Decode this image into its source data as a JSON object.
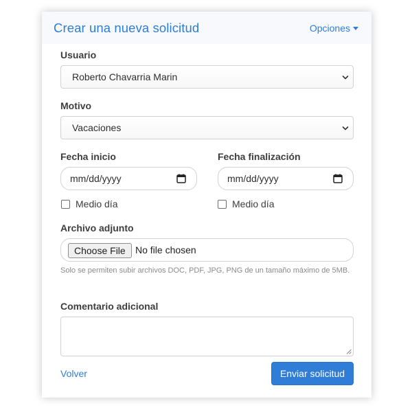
{
  "header": {
    "title": "Crear una nueva solicitud",
    "options_label": "Opciones",
    "options_icon": "caret-down-icon"
  },
  "form": {
    "usuario": {
      "label": "Usuario",
      "selected": "Roberto Chavarria Marin"
    },
    "motivo": {
      "label": "Motivo",
      "selected": "Vacaciones"
    },
    "fecha_inicio": {
      "label": "Fecha inicio",
      "placeholder": "mm/dd/yyyy",
      "half_day_label": "Medio día",
      "half_day_checked": false
    },
    "fecha_fin": {
      "label": "Fecha finalización",
      "placeholder": "mm/dd/yyyy",
      "half_day_label": "Medio día",
      "half_day_checked": false
    },
    "archivo": {
      "label": "Archivo adjunto",
      "button_label": "Choose File",
      "status": "No file chosen",
      "help": "Solo se permiten subir archivos DOC, PDF, JPG, PNG de un tamaño máximo de 5MB."
    },
    "comentario": {
      "label": "Comentario adicional",
      "value": ""
    }
  },
  "footer": {
    "back_label": "Volver",
    "submit_label": "Enviar solicitud"
  },
  "colors": {
    "accent": "#2f7dd6",
    "header_bg": "#f8f9fc",
    "border": "#cfd3d8"
  }
}
